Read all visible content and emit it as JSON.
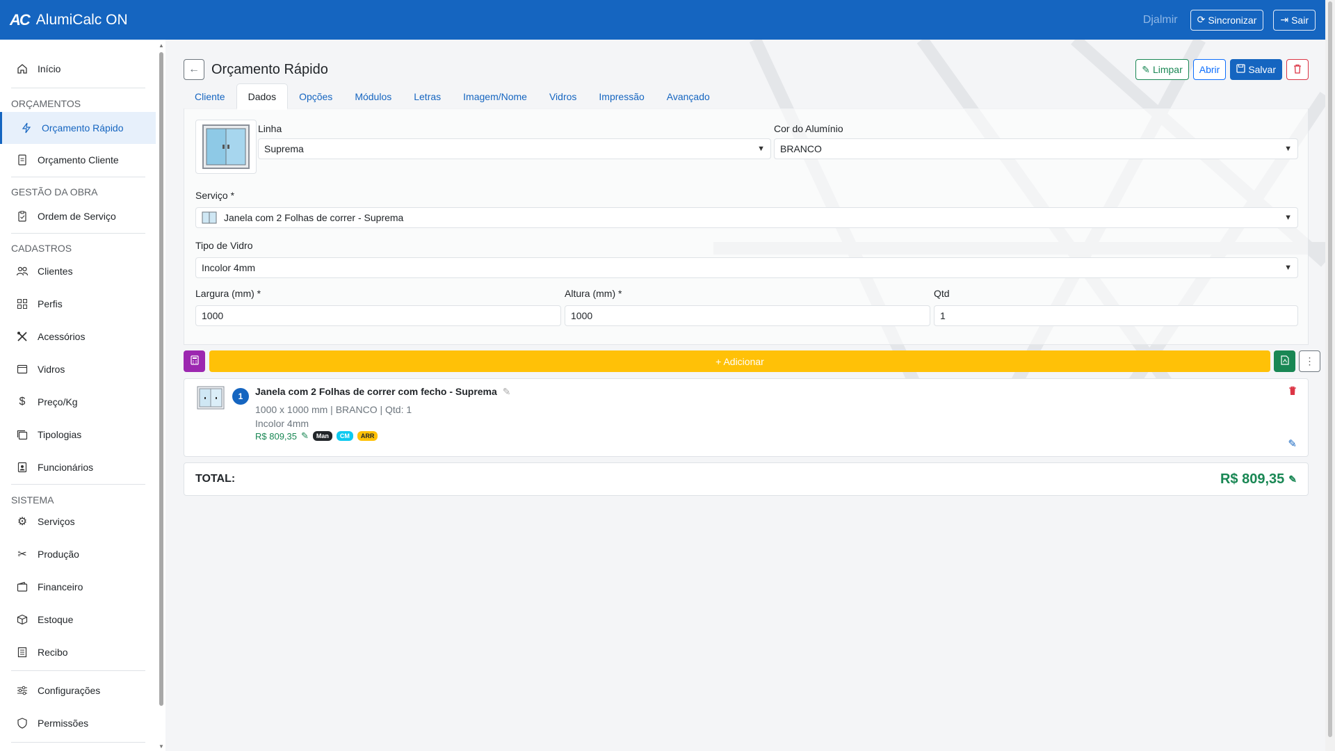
{
  "app": {
    "name": "AlumiCalc ON",
    "logo_text": "AC"
  },
  "topbar": {
    "user": "Djalmir",
    "sync_label": "Sincronizar",
    "logout_label": "Sair"
  },
  "sidebar": {
    "home": "Início",
    "sections": {
      "orcamentos": "ORÇAMENTOS",
      "gestao": "GESTÃO DA OBRA",
      "cadastros": "CADASTROS",
      "sistema": "SISTEMA"
    },
    "items": {
      "orcamento_rapido": "Orçamento Rápido",
      "orcamento_cliente": "Orçamento Cliente",
      "ordem_servico": "Ordem de Serviço",
      "clientes": "Clientes",
      "perfis": "Perfis",
      "acessorios": "Acessórios",
      "vidros": "Vidros",
      "preco_kg": "Preço/Kg",
      "tipologias": "Tipologias",
      "funcionarios": "Funcionários",
      "servicos": "Serviços",
      "producao": "Produção",
      "financeiro": "Financeiro",
      "estoque": "Estoque",
      "recibo": "Recibo",
      "configuracoes": "Configurações",
      "permissoes": "Permissões"
    }
  },
  "page": {
    "title": "Orçamento Rápido",
    "actions": {
      "limpar": "Limpar",
      "abrir": "Abrir",
      "salvar": "Salvar"
    },
    "tabs": [
      "Cliente",
      "Dados",
      "Opções",
      "Módulos",
      "Letras",
      "Imagem/Nome",
      "Vidros",
      "Impressão",
      "Avançado"
    ],
    "active_tab": "Dados"
  },
  "form": {
    "linha_label": "Linha",
    "linha_value": "Suprema",
    "cor_label": "Cor do Alumínio",
    "cor_value": "BRANCO",
    "servico_label": "Serviço *",
    "servico_value": "Janela com 2 Folhas de correr - Suprema",
    "vidro_label": "Tipo de Vidro",
    "vidro_value": "Incolor 4mm",
    "largura_label": "Largura (mm) *",
    "largura_value": "1000",
    "altura_label": "Altura (mm) *",
    "altura_value": "1000",
    "qtd_label": "Qtd",
    "qtd_value": "1"
  },
  "actions_bar": {
    "add_label": "+ Adicionar"
  },
  "items": [
    {
      "num": "1",
      "title": "Janela com 2 Folhas de correr com fecho - Suprema",
      "dims": "1000 x 1000 mm | BRANCO | Qtd: 1",
      "glass": "Incolor 4mm",
      "price": "R$ 809,35",
      "badges": [
        "Man",
        "CM",
        "ARR"
      ]
    }
  ],
  "total": {
    "label": "TOTAL:",
    "value": "R$ 809,35"
  },
  "colors": {
    "primary": "#1565c0",
    "success": "#198754",
    "warning": "#ffc107",
    "danger": "#dc3545",
    "purple": "#9c27b0"
  }
}
